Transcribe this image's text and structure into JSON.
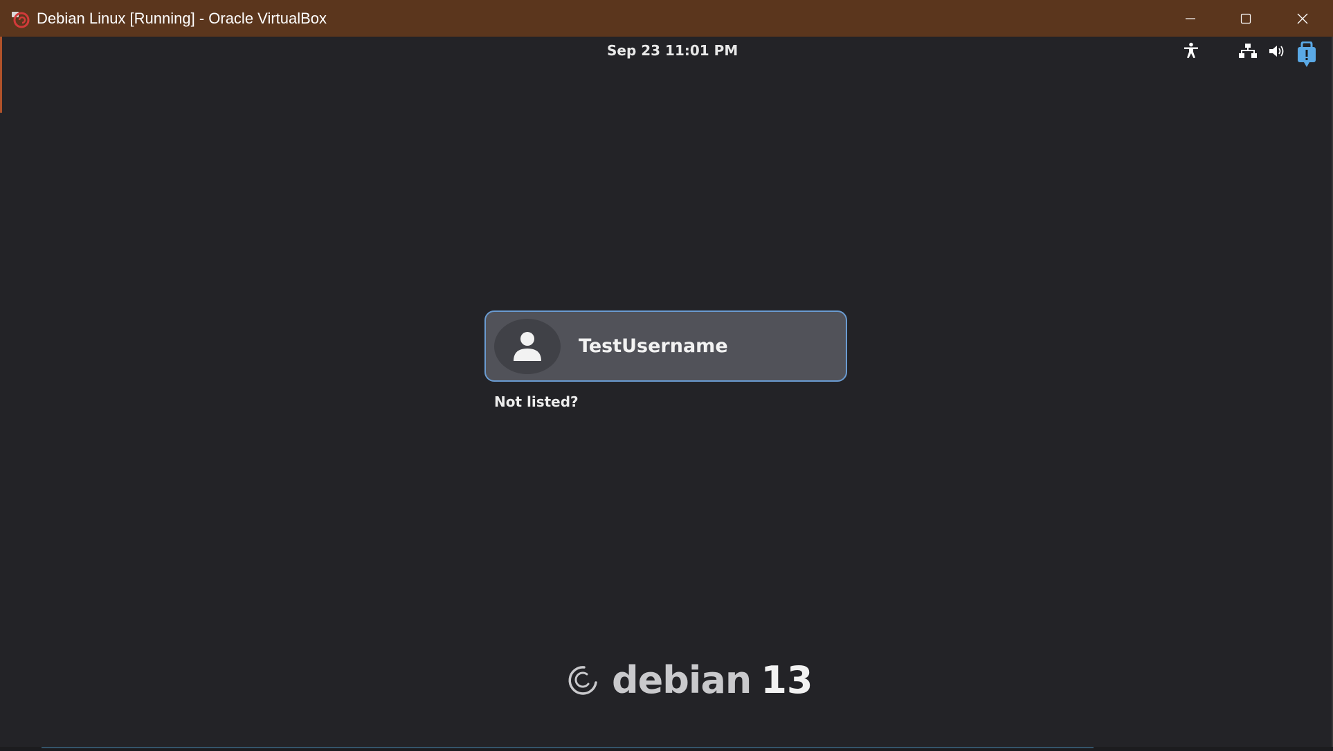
{
  "window": {
    "title": "Debian Linux [Running] - Oracle VirtualBox",
    "controls": {
      "minimize_icon": "minimize-icon",
      "maximize_icon": "maximize-icon",
      "close_icon": "close-icon"
    },
    "titlebar_color": "#5b361d"
  },
  "topbar": {
    "clock": "Sep 23  11:01 PM",
    "tray": [
      "accessibility-icon",
      "network-wired-icon",
      "volume-icon",
      "virtualbox-notification-icon"
    ]
  },
  "login": {
    "user": {
      "name": "TestUsername",
      "avatar_icon": "user-avatar-icon"
    },
    "not_listed": "Not listed?",
    "accent_color": "#6a9bd1"
  },
  "branding": {
    "logo_icon": "debian-swirl-logo",
    "word": "debian",
    "version": "13"
  }
}
